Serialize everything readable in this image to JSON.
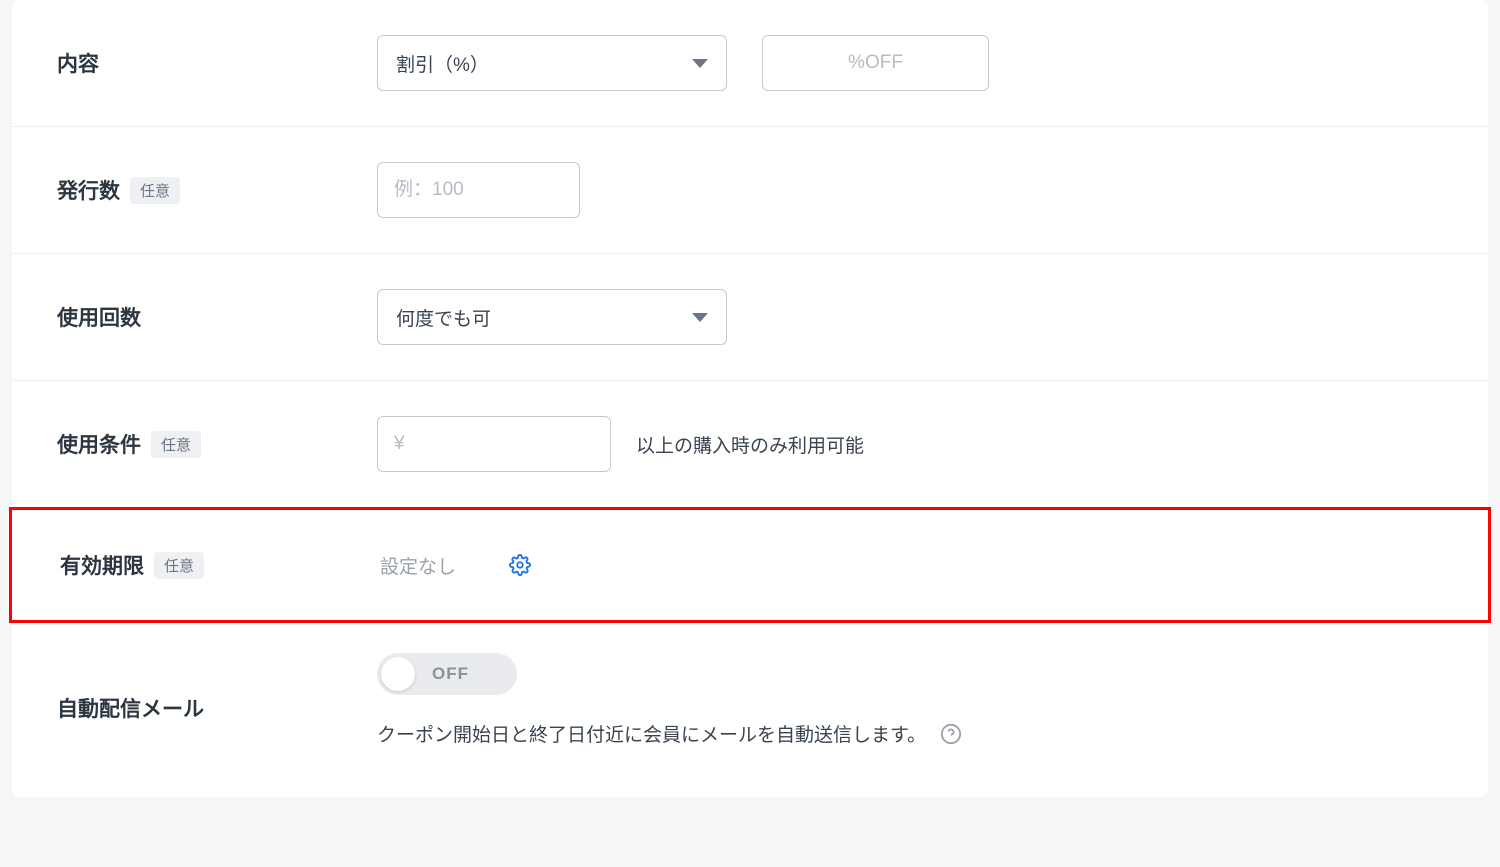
{
  "rows": {
    "content": {
      "label": "内容",
      "select_value": "割引（%）",
      "percent_placeholder": "%OFF"
    },
    "issue_count": {
      "label": "発行数",
      "badge": "任意",
      "placeholder": "例：100"
    },
    "usage_count": {
      "label": "使用回数",
      "select_value": "何度でも可"
    },
    "usage_condition": {
      "label": "使用条件",
      "badge": "任意",
      "placeholder": "¥",
      "suffix": "以上の購入時のみ利用可能"
    },
    "expiration": {
      "label": "有効期限",
      "badge": "任意",
      "value": "設定なし"
    },
    "auto_mail": {
      "label": "自動配信メール",
      "toggle_state": "OFF",
      "help": "クーポン開始日と終了日付近に会員にメールを自動送信します。"
    }
  }
}
